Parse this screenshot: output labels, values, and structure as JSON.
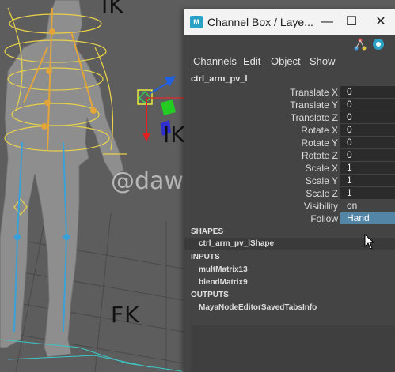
{
  "viewport": {
    "labels": {
      "ik_top": "IK",
      "ik_mid": "IK",
      "fk": "FK"
    },
    "watermark": "@dawn_arc",
    "colors": {
      "rig_yellow": "#e8d24a",
      "joint_blue": "#3aa0d8",
      "mesh": "#8e8e8e",
      "pv_green": "#33cc55"
    }
  },
  "window": {
    "title": "Channel Box / Laye...",
    "app_icon": "M",
    "controls": {
      "minimize": "—",
      "maximize": "☐",
      "close": "✕"
    },
    "toolbar_icons": [
      "node-tree-icon",
      "help-circle-icon"
    ],
    "menus": [
      "Channels",
      "Edit",
      "Object",
      "Show"
    ],
    "node_name": "ctrl_arm_pv_l",
    "attributes": [
      {
        "label": "Translate X",
        "value": "0"
      },
      {
        "label": "Translate Y",
        "value": "0"
      },
      {
        "label": "Translate Z",
        "value": "0"
      },
      {
        "label": "Rotate X",
        "value": "0"
      },
      {
        "label": "Rotate Y",
        "value": "0"
      },
      {
        "label": "Rotate Z",
        "value": "0"
      },
      {
        "label": "Scale X",
        "value": "1"
      },
      {
        "label": "Scale Y",
        "value": "1"
      },
      {
        "label": "Scale Z",
        "value": "1"
      },
      {
        "label": "Visibility",
        "value": "on"
      },
      {
        "label": "Follow",
        "value": "Hand"
      }
    ],
    "sections": {
      "shapes": {
        "title": "SHAPES",
        "items": [
          "ctrl_arm_pv_lShape"
        ]
      },
      "inputs": {
        "title": "INPUTS",
        "items": [
          "multMatrix13",
          "blendMatrix9"
        ]
      },
      "outputs": {
        "title": "OUTPUTS",
        "items": [
          "MayaNodeEditorSavedTabsInfo"
        ]
      }
    },
    "colors": {
      "panel": "#444444",
      "field": "#2b2b2b",
      "selected": "#5285a6",
      "titlebar": "#f3f3f3"
    }
  }
}
